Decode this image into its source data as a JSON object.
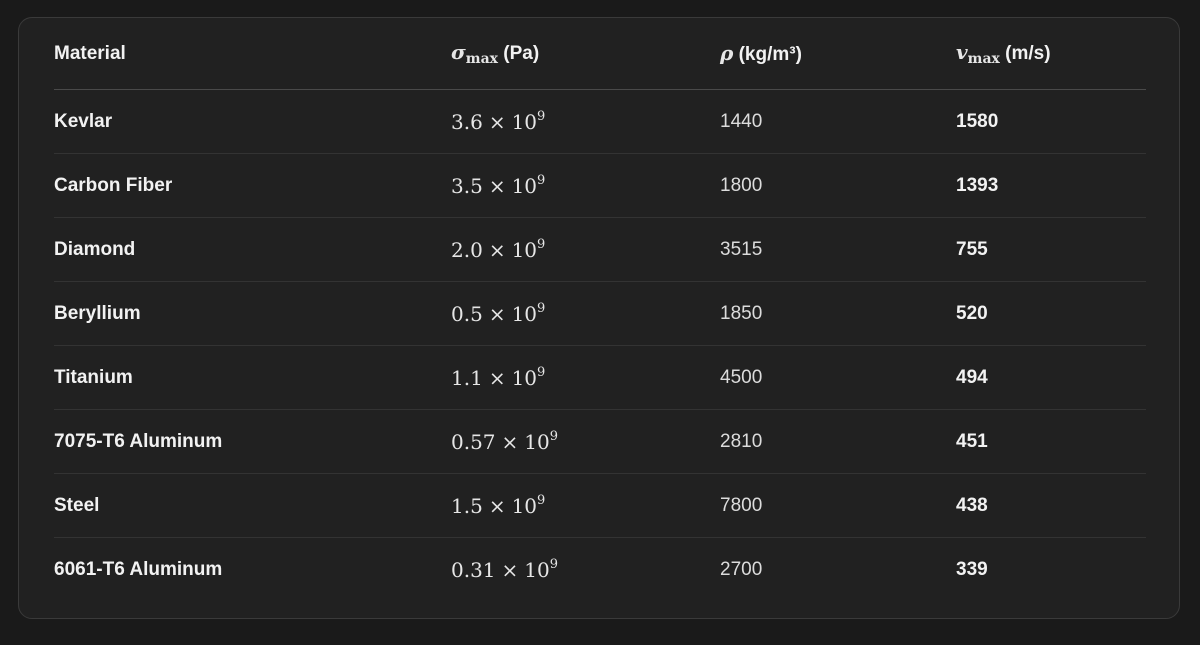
{
  "table": {
    "headers": {
      "material": "Material",
      "stress_symbol": "σ",
      "stress_sub": "max",
      "stress_unit": "(Pa)",
      "density_symbol": "ρ",
      "density_unit": "(kg/m³)",
      "velocity_symbol": "v",
      "velocity_sub": "max",
      "velocity_unit": "(m/s)"
    },
    "times_symbol": "×",
    "exponent_base": "10",
    "exponent_power": "9",
    "rows": [
      {
        "material": "Kevlar",
        "stress_mantissa": "3.6",
        "density": "1440",
        "velocity": "1580"
      },
      {
        "material": "Carbon Fiber",
        "stress_mantissa": "3.5",
        "density": "1800",
        "velocity": "1393"
      },
      {
        "material": "Diamond",
        "stress_mantissa": "2.0",
        "density": "3515",
        "velocity": "755"
      },
      {
        "material": "Beryllium",
        "stress_mantissa": "0.5",
        "density": "1850",
        "velocity": "520"
      },
      {
        "material": "Titanium",
        "stress_mantissa": "1.1",
        "density": "4500",
        "velocity": "494"
      },
      {
        "material": "7075-T6 Aluminum",
        "stress_mantissa": "0.57",
        "density": "2810",
        "velocity": "451"
      },
      {
        "material": "Steel",
        "stress_mantissa": "1.5",
        "density": "7800",
        "velocity": "438"
      },
      {
        "material": "6061-T6 Aluminum",
        "stress_mantissa": "0.31",
        "density": "2700",
        "velocity": "339"
      }
    ]
  }
}
